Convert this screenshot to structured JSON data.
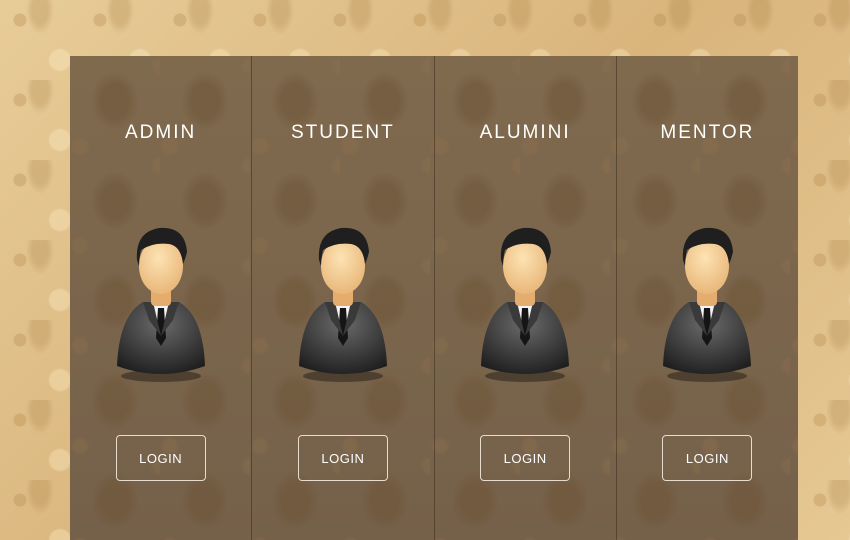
{
  "roles": [
    {
      "title": "ADMIN",
      "button": "LOGIN",
      "icon": "user-avatar-icon"
    },
    {
      "title": "STUDENT",
      "button": "LOGIN",
      "icon": "user-avatar-icon"
    },
    {
      "title": "ALUMINI",
      "button": "LOGIN",
      "icon": "user-avatar-icon"
    },
    {
      "title": "MENTOR",
      "button": "LOGIN",
      "icon": "user-avatar-icon"
    }
  ],
  "colors": {
    "page_background": "#e2c490",
    "panel_background": "#7a6348",
    "text": "#ffffff",
    "button_border": "#e7dccd"
  }
}
